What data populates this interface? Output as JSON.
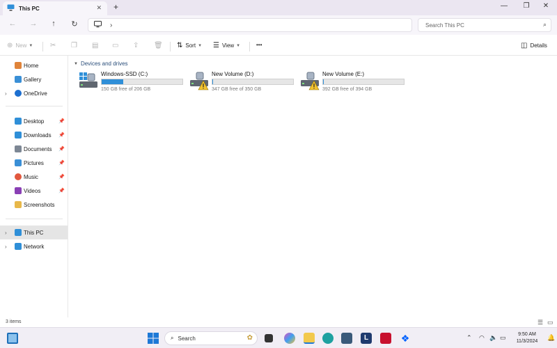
{
  "window": {
    "tab_title": "This PC",
    "tab_close": "✕",
    "new_tab": "+",
    "minimize": "—",
    "maximize": "❐",
    "close": "✕"
  },
  "address": {
    "separator": "›",
    "search_placeholder": "Search This PC"
  },
  "commands": {
    "new": "New",
    "sort": "Sort",
    "view": "View",
    "more": "•••",
    "details": "Details"
  },
  "sidebar": {
    "items": [
      {
        "label": "Home",
        "color": "#e0843a"
      },
      {
        "label": "Gallery",
        "color": "#3a8fd6"
      },
      {
        "label": "OneDrive",
        "color": "#1d6fd0"
      },
      {
        "label": "Desktop",
        "color": "#2f8fd8"
      },
      {
        "label": "Downloads",
        "color": "#2f8fd8"
      },
      {
        "label": "Documents",
        "color": "#7d8794"
      },
      {
        "label": "Pictures",
        "color": "#3a8fd6"
      },
      {
        "label": "Music",
        "color": "#e2583e"
      },
      {
        "label": "Videos",
        "color": "#8a3fb5"
      },
      {
        "label": "Screenshots",
        "color": "#e8b84a"
      },
      {
        "label": "This PC",
        "color": "#2f8fd8"
      },
      {
        "label": "Network",
        "color": "#2f8fd8"
      }
    ]
  },
  "main": {
    "group_header": "Devices and drives",
    "drives": [
      {
        "name": "Windows-SSD (C:)",
        "free_text": "150 GB free of 206 GB",
        "used_fraction": 0.27,
        "warning": false
      },
      {
        "name": "New Volume (D:)",
        "free_text": "347 GB free of 350 GB",
        "used_fraction": 0.01,
        "warning": true
      },
      {
        "name": "New Volume (E:)",
        "free_text": "392 GB free of 394 GB",
        "used_fraction": 0.005,
        "warning": true
      }
    ]
  },
  "status": {
    "items_count": "3 items"
  },
  "taskbar": {
    "search_label": "Search",
    "time": "9:50 AM",
    "date": "11/3/2024",
    "app_l_label": "L"
  },
  "colors": {
    "accent": "#2f8fd8",
    "warning": "#f2c230"
  }
}
